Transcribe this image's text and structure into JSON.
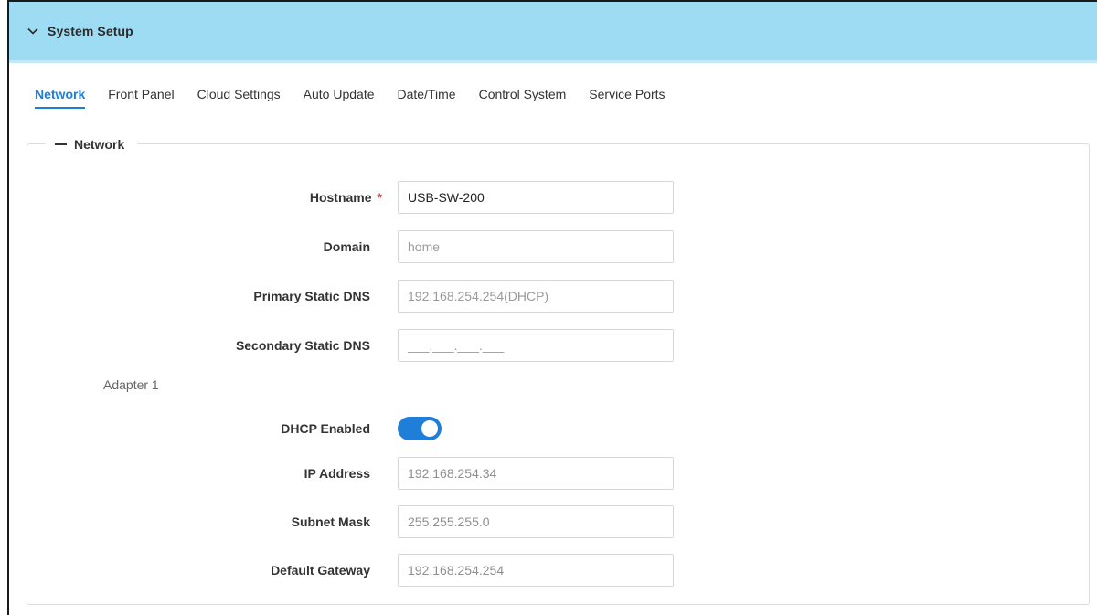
{
  "header": {
    "title": "System Setup",
    "collapse_icon": "chevron-down-icon"
  },
  "tabs": [
    {
      "label": "Network",
      "active": true
    },
    {
      "label": "Front Panel",
      "active": false
    },
    {
      "label": "Cloud Settings",
      "active": false
    },
    {
      "label": "Auto Update",
      "active": false
    },
    {
      "label": "Date/Time",
      "active": false
    },
    {
      "label": "Control System",
      "active": false
    },
    {
      "label": "Service Ports",
      "active": false
    }
  ],
  "network": {
    "legend": "Network",
    "hostname": {
      "label": "Hostname",
      "required_mark": "*",
      "value": "USB-SW-200"
    },
    "domain": {
      "label": "Domain",
      "placeholder": "home"
    },
    "primary_dns": {
      "label": "Primary Static DNS",
      "placeholder": "192.168.254.254(DHCP)"
    },
    "secondary_dns": {
      "label": "Secondary Static DNS",
      "placeholder": "___.___.___.___"
    },
    "adapter": {
      "title": "Adapter 1",
      "dhcp": {
        "label": "DHCP Enabled",
        "enabled": true
      },
      "ip_address": {
        "label": "IP Address",
        "value": "192.168.254.34"
      },
      "subnet_mask": {
        "label": "Subnet Mask",
        "value": "255.255.255.0"
      },
      "default_gateway": {
        "label": "Default Gateway",
        "value": "192.168.254.254"
      }
    }
  },
  "colors": {
    "header_bg": "#9edcf3",
    "accent": "#1f7fd8",
    "required": "#e0454a"
  }
}
